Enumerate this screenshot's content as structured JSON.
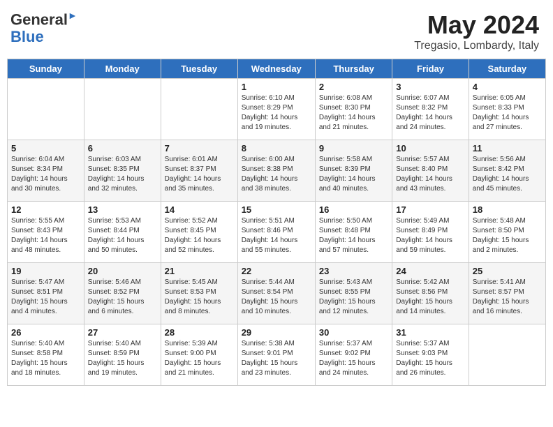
{
  "header": {
    "logo_line1": "General",
    "logo_line2": "Blue",
    "title": "May 2024",
    "subtitle": "Tregasio, Lombardy, Italy"
  },
  "days_of_week": [
    "Sunday",
    "Monday",
    "Tuesday",
    "Wednesday",
    "Thursday",
    "Friday",
    "Saturday"
  ],
  "weeks": [
    [
      {
        "day": "",
        "info": ""
      },
      {
        "day": "",
        "info": ""
      },
      {
        "day": "",
        "info": ""
      },
      {
        "day": "1",
        "info": "Sunrise: 6:10 AM\nSunset: 8:29 PM\nDaylight: 14 hours\nand 19 minutes."
      },
      {
        "day": "2",
        "info": "Sunrise: 6:08 AM\nSunset: 8:30 PM\nDaylight: 14 hours\nand 21 minutes."
      },
      {
        "day": "3",
        "info": "Sunrise: 6:07 AM\nSunset: 8:32 PM\nDaylight: 14 hours\nand 24 minutes."
      },
      {
        "day": "4",
        "info": "Sunrise: 6:05 AM\nSunset: 8:33 PM\nDaylight: 14 hours\nand 27 minutes."
      }
    ],
    [
      {
        "day": "5",
        "info": "Sunrise: 6:04 AM\nSunset: 8:34 PM\nDaylight: 14 hours\nand 30 minutes."
      },
      {
        "day": "6",
        "info": "Sunrise: 6:03 AM\nSunset: 8:35 PM\nDaylight: 14 hours\nand 32 minutes."
      },
      {
        "day": "7",
        "info": "Sunrise: 6:01 AM\nSunset: 8:37 PM\nDaylight: 14 hours\nand 35 minutes."
      },
      {
        "day": "8",
        "info": "Sunrise: 6:00 AM\nSunset: 8:38 PM\nDaylight: 14 hours\nand 38 minutes."
      },
      {
        "day": "9",
        "info": "Sunrise: 5:58 AM\nSunset: 8:39 PM\nDaylight: 14 hours\nand 40 minutes."
      },
      {
        "day": "10",
        "info": "Sunrise: 5:57 AM\nSunset: 8:40 PM\nDaylight: 14 hours\nand 43 minutes."
      },
      {
        "day": "11",
        "info": "Sunrise: 5:56 AM\nSunset: 8:42 PM\nDaylight: 14 hours\nand 45 minutes."
      }
    ],
    [
      {
        "day": "12",
        "info": "Sunrise: 5:55 AM\nSunset: 8:43 PM\nDaylight: 14 hours\nand 48 minutes."
      },
      {
        "day": "13",
        "info": "Sunrise: 5:53 AM\nSunset: 8:44 PM\nDaylight: 14 hours\nand 50 minutes."
      },
      {
        "day": "14",
        "info": "Sunrise: 5:52 AM\nSunset: 8:45 PM\nDaylight: 14 hours\nand 52 minutes."
      },
      {
        "day": "15",
        "info": "Sunrise: 5:51 AM\nSunset: 8:46 PM\nDaylight: 14 hours\nand 55 minutes."
      },
      {
        "day": "16",
        "info": "Sunrise: 5:50 AM\nSunset: 8:48 PM\nDaylight: 14 hours\nand 57 minutes."
      },
      {
        "day": "17",
        "info": "Sunrise: 5:49 AM\nSunset: 8:49 PM\nDaylight: 14 hours\nand 59 minutes."
      },
      {
        "day": "18",
        "info": "Sunrise: 5:48 AM\nSunset: 8:50 PM\nDaylight: 15 hours\nand 2 minutes."
      }
    ],
    [
      {
        "day": "19",
        "info": "Sunrise: 5:47 AM\nSunset: 8:51 PM\nDaylight: 15 hours\nand 4 minutes."
      },
      {
        "day": "20",
        "info": "Sunrise: 5:46 AM\nSunset: 8:52 PM\nDaylight: 15 hours\nand 6 minutes."
      },
      {
        "day": "21",
        "info": "Sunrise: 5:45 AM\nSunset: 8:53 PM\nDaylight: 15 hours\nand 8 minutes."
      },
      {
        "day": "22",
        "info": "Sunrise: 5:44 AM\nSunset: 8:54 PM\nDaylight: 15 hours\nand 10 minutes."
      },
      {
        "day": "23",
        "info": "Sunrise: 5:43 AM\nSunset: 8:55 PM\nDaylight: 15 hours\nand 12 minutes."
      },
      {
        "day": "24",
        "info": "Sunrise: 5:42 AM\nSunset: 8:56 PM\nDaylight: 15 hours\nand 14 minutes."
      },
      {
        "day": "25",
        "info": "Sunrise: 5:41 AM\nSunset: 8:57 PM\nDaylight: 15 hours\nand 16 minutes."
      }
    ],
    [
      {
        "day": "26",
        "info": "Sunrise: 5:40 AM\nSunset: 8:58 PM\nDaylight: 15 hours\nand 18 minutes."
      },
      {
        "day": "27",
        "info": "Sunrise: 5:40 AM\nSunset: 8:59 PM\nDaylight: 15 hours\nand 19 minutes."
      },
      {
        "day": "28",
        "info": "Sunrise: 5:39 AM\nSunset: 9:00 PM\nDaylight: 15 hours\nand 21 minutes."
      },
      {
        "day": "29",
        "info": "Sunrise: 5:38 AM\nSunset: 9:01 PM\nDaylight: 15 hours\nand 23 minutes."
      },
      {
        "day": "30",
        "info": "Sunrise: 5:37 AM\nSunset: 9:02 PM\nDaylight: 15 hours\nand 24 minutes."
      },
      {
        "day": "31",
        "info": "Sunrise: 5:37 AM\nSunset: 9:03 PM\nDaylight: 15 hours\nand 26 minutes."
      },
      {
        "day": "",
        "info": ""
      }
    ]
  ]
}
